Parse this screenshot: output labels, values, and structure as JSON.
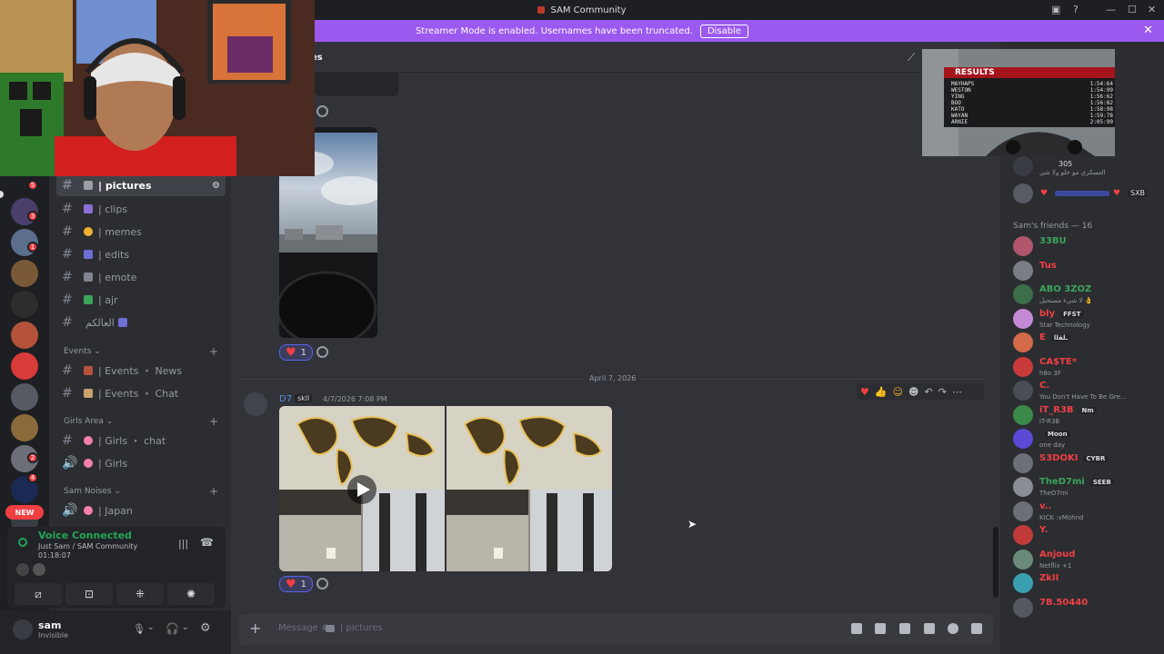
{
  "window": {
    "title": "SAM Community"
  },
  "banner": {
    "text": "Streamer Mode is enabled. Usernames have been truncated.",
    "button": "Disable"
  },
  "rail": {
    "badges": [
      "5",
      "3",
      "1",
      "2",
      "4",
      "NEW"
    ]
  },
  "header": {
    "channel_partial": "es"
  },
  "sidebar": {
    "channels_top": [
      {
        "label": "| pictures",
        "active": true
      },
      {
        "label": "| clips"
      },
      {
        "label": "| memes"
      },
      {
        "label": "| edits"
      },
      {
        "label": "| emote"
      },
      {
        "label": "| ajr"
      },
      {
        "label": "العالكم"
      }
    ],
    "cat_events": "Events",
    "events": [
      {
        "label": "| Events ・ News"
      },
      {
        "label": "| Events ・ Chat"
      }
    ],
    "cat_girls": "Girls Area",
    "girls": [
      {
        "label": "| Girls ・ chat"
      },
      {
        "label": "| Girls"
      }
    ],
    "cat_noises": "Sam Noises",
    "noises": [
      {
        "label": "| Japan"
      }
    ]
  },
  "voice": {
    "status": "Voice Connected",
    "location": "Just Sam / SAM Community",
    "timer": "01:18:07"
  },
  "user": {
    "name": "sam",
    "status": "Invisible"
  },
  "messages": {
    "reaction_count_1": "1",
    "date_divider": "April 7, 2026",
    "author": "D7",
    "author_tag": "skll",
    "timestamp": "4/7/2026 7:08 PM",
    "reaction_count_2": "1"
  },
  "composer": {
    "placeholder": "Message #",
    "channel": "| pictures"
  },
  "game_overlay": {
    "title": "RESULTS",
    "rows": [
      {
        "name": "MAYHAPS",
        "time": "1:54:64"
      },
      {
        "name": "WESTON",
        "time": "1:54:99"
      },
      {
        "name": "YING",
        "time": "1:56:62"
      },
      {
        "name": "BOO",
        "time": "1:56:82"
      },
      {
        "name": "KATO",
        "time": "1:58:98"
      },
      {
        "name": "WAYAN",
        "time": "1:59:78"
      },
      {
        "name": "ARNIE",
        "time": "2:05:99"
      }
    ]
  },
  "members": {
    "top_tag": "305",
    "top_status": "العسكري مو حلو ولا شي",
    "sxb_tag": "SXB",
    "section": "Sam's friends — 16",
    "list": [
      {
        "name": "33BU",
        "color": "#3ba55c",
        "status": "",
        "tag": ""
      },
      {
        "name": "Tus",
        "color": "#f23f43",
        "status": "",
        "tag": ""
      },
      {
        "name": "ABO 3ZOZ",
        "color": "#3ba55c",
        "status": "لا شيء مستحيل 👌",
        "tag": ""
      },
      {
        "name": "bly",
        "color": "#f23f43",
        "status": "Star Technology",
        "tag": "FFST"
      },
      {
        "name": "E",
        "color": "#f23f43",
        "status": "",
        "tag": "ـﻠﻘﻟا"
      },
      {
        "name": "CA$TE*",
        "color": "#f23f43",
        "status": "h8o 3F",
        "tag": ""
      },
      {
        "name": "C.",
        "color": "#f23f43",
        "status": "You Don't Have To Be Gre...",
        "tag": ""
      },
      {
        "name": "iT_R3B",
        "color": "#f23f43",
        "status": "iT-R3B",
        "tag": "Nm"
      },
      {
        "name": "",
        "color": "#f23f43",
        "status": "one day",
        "tag": "Moon"
      },
      {
        "name": "S3DOKI",
        "color": "#f23f43",
        "status": "",
        "tag": "CYBR"
      },
      {
        "name": "TheD7mi",
        "color": "#3ba55c",
        "status": "TheD7mi",
        "tag": "SEEB"
      },
      {
        "name": "v..",
        "color": "#f23f43",
        "status": "KICK :vMohnd",
        "tag": ""
      },
      {
        "name": "Y.",
        "color": "#f23f43",
        "status": "",
        "tag": ""
      },
      {
        "name": "Anjoud",
        "color": "#f23f43",
        "status": "Netflix +1",
        "tag": ""
      },
      {
        "name": "ZkII",
        "color": "#f23f43",
        "status": "",
        "tag": ""
      },
      {
        "name": "7B.50440",
        "color": "#f23f43",
        "status": "",
        "tag": ""
      }
    ]
  }
}
